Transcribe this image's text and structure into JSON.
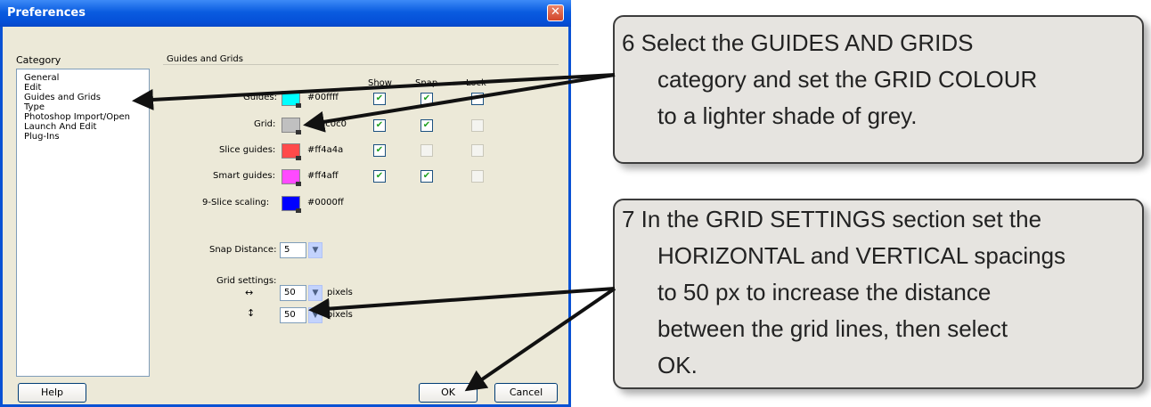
{
  "dialog": {
    "title": "Preferences",
    "close_icon": "close-icon",
    "category_label": "Category",
    "categories": [
      "General",
      "Edit",
      "Guides and Grids",
      "Type",
      "Photoshop Import/Open",
      "Launch And Edit",
      "Plug-Ins"
    ],
    "section_title": "Guides and Grids",
    "columns": {
      "show": "Show",
      "snap": "Snap",
      "lock": "Lock"
    },
    "rows": [
      {
        "label": "Guides:",
        "color": "#00ffff",
        "hex": "#00ffff",
        "show": true,
        "snap": true,
        "lock": false,
        "lock_enabled": true
      },
      {
        "label": "Grid:",
        "color": "#c0c0c0",
        "hex": "#c0c0c0",
        "show": true,
        "snap": true,
        "lock": false,
        "lock_enabled": false
      },
      {
        "label": "Slice guides:",
        "color": "#ff4a4a",
        "hex": "#ff4a4a",
        "show": true,
        "snap": false,
        "lock": false,
        "lock_enabled": false
      },
      {
        "label": "Smart guides:",
        "color": "#ff4aff",
        "hex": "#ff4aff",
        "show": true,
        "snap": true,
        "lock": false,
        "lock_enabled": false
      }
    ],
    "nine_slice": {
      "label": "9-Slice scaling:",
      "color": "#0000ff",
      "hex": "#0000ff"
    },
    "snap_distance": {
      "label": "Snap Distance:",
      "value": "5"
    },
    "grid_settings": {
      "label": "Grid settings:",
      "h_icon": "↔",
      "v_icon": "↕",
      "h_value": "50",
      "v_value": "50",
      "unit": "pixels"
    },
    "buttons": {
      "help": "Help",
      "ok": "OK",
      "cancel": "Cancel"
    }
  },
  "callouts": [
    {
      "lines": [
        "6  Select the GUIDES AND GRIDS",
        "category and set the GRID COLOUR",
        "to a lighter shade of grey."
      ]
    },
    {
      "lines": [
        "7  In the GRID SETTINGS section set the",
        "HORIZONTAL and VERTICAL spacings",
        "to 50 px to increase the distance",
        "between the grid lines, then select",
        "OK."
      ]
    }
  ]
}
